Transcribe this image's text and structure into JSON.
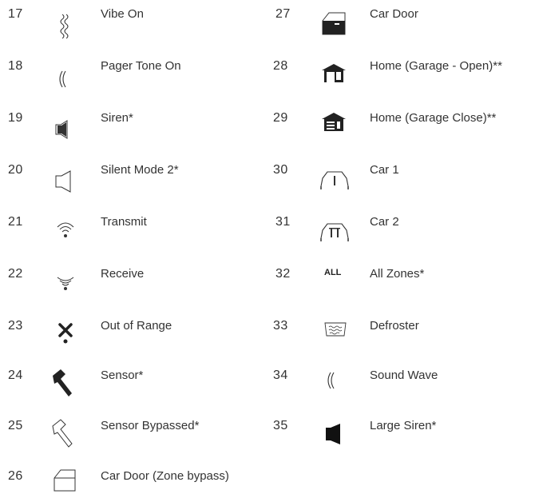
{
  "left": [
    {
      "num": "17",
      "icon": "vibe-icon",
      "label": "Vibe On"
    },
    {
      "num": "18",
      "icon": "pager-tone-icon",
      "label": "Pager Tone On"
    },
    {
      "num": "19",
      "icon": "siren-icon",
      "label": "Siren*"
    },
    {
      "num": "20",
      "icon": "silent-mode-icon",
      "label": "Silent Mode 2*"
    },
    {
      "num": "21",
      "icon": "transmit-icon",
      "label": "Transmit"
    },
    {
      "num": "22",
      "icon": "receive-icon",
      "label": "Receive"
    },
    {
      "num": "23",
      "icon": "out-of-range-icon",
      "label": "Out of Range"
    },
    {
      "num": "24",
      "icon": "sensor-icon",
      "label": "Sensor*"
    },
    {
      "num": "25",
      "icon": "sensor-bypassed-icon",
      "label": "Sensor Bypassed*"
    },
    {
      "num": "26",
      "icon": "car-door-bypass-icon",
      "label": "Car Door (Zone bypass)"
    }
  ],
  "right": [
    {
      "num": "27",
      "icon": "car-door-icon",
      "label": "Car Door"
    },
    {
      "num": "28",
      "icon": "garage-open-icon",
      "label": "Home (Garage - Open)**"
    },
    {
      "num": "29",
      "icon": "garage-close-icon",
      "label": "Home (Garage Close)**"
    },
    {
      "num": "30",
      "icon": "car-1-icon",
      "label": "Car 1"
    },
    {
      "num": "31",
      "icon": "car-2-icon",
      "label": "Car 2"
    },
    {
      "num": "32",
      "icon": "all-zones-icon",
      "label": "All Zones*",
      "icon_text": "ALL"
    },
    {
      "num": "33",
      "icon": "defroster-icon",
      "label": "Defroster"
    },
    {
      "num": "34",
      "icon": "sound-wave-icon",
      "label": "Sound Wave"
    },
    {
      "num": "35",
      "icon": "large-siren-icon",
      "label": "Large Siren*"
    }
  ]
}
